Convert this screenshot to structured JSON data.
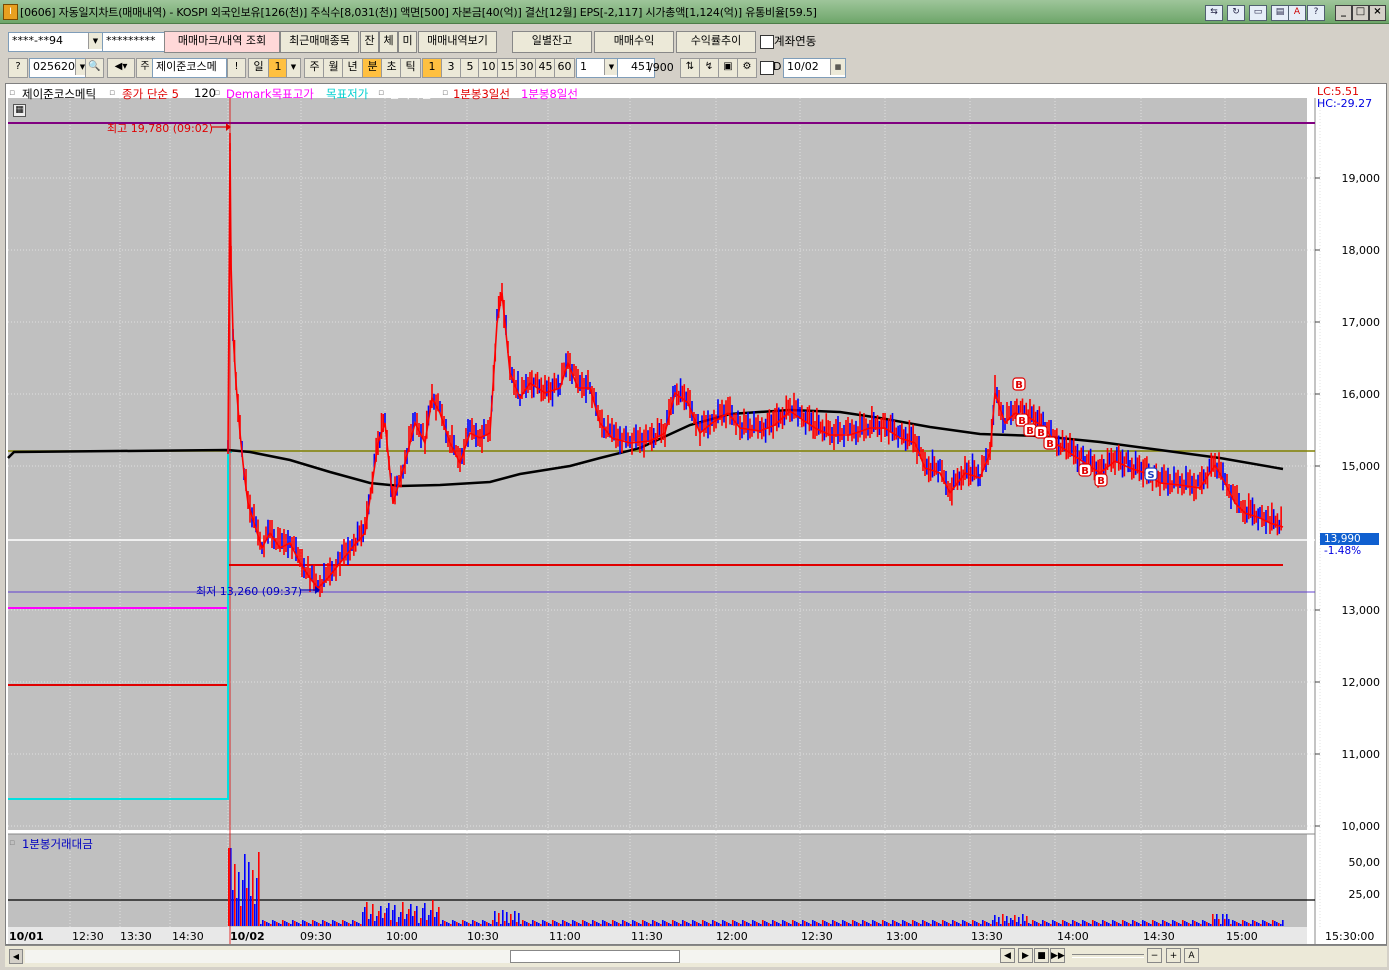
{
  "window": {
    "title": "[0606] 자동일지차트(매매내역) - KOSPI 외국인보유[126(천)] 주식수[8,031(천)] 액면[500] 자본금[40(억)] 결산[12월] EPS[-2,117] 시가총액[1,124(억)] 유통비율[59.5]",
    "app_icon": "I"
  },
  "toolbar1": {
    "account": "****-**94",
    "password": "*********",
    "btn_mark": "매매마크/내역 조회",
    "btn_recent": "최근매매종목",
    "btn_jan": "잔",
    "btn_che": "체",
    "btn_mi": "미",
    "btn_history": "매매내역보기",
    "btn_daily": "일별잔고",
    "btn_profit": "매매수익",
    "btn_return": "수익률추이",
    "chk_link": "계좌연동"
  },
  "toolbar2": {
    "code": "025620",
    "stock_name": "제이준코스메",
    "btn_excl": "!",
    "period_day": "일",
    "period_val": "1",
    "week": "주",
    "month": "월",
    "year": "년",
    "minute": "분",
    "second": "초",
    "tick": "틱",
    "intervals": [
      "1",
      "3",
      "5",
      "10",
      "15",
      "30",
      "45",
      "60"
    ],
    "interval_val": "1",
    "count": "451",
    "count_max": "/900",
    "chk_d": "D",
    "date": "10/02"
  },
  "legend": {
    "name": "제이준코스메틱",
    "close": "종가 단순 5",
    "close_val": "120",
    "demark": "Demark목표고가",
    "target_low": "목표저가",
    "short_over": "단기과열",
    "line3": "1분봉3일선",
    "line8": "1분봉8일선",
    "volume_label": "1분봉거래대금",
    "lc": "LC:5.51",
    "hc": "HC:-29.27"
  },
  "annotations": {
    "high": "최고 19,780 (09:02)",
    "low": "최저 13,260 (09:37)",
    "current_price": "13,990",
    "current_change": "-1.48%"
  },
  "axes": {
    "y_ticks": [
      "19,000",
      "18,000",
      "17,000",
      "16,000",
      "15,000",
      "13,000",
      "12,000",
      "11,000",
      "10,000"
    ],
    "vol_ticks": [
      "50,00",
      "25,00"
    ],
    "x_ticks": [
      "10/01",
      "12:30",
      "13:30",
      "14:30",
      "10/02",
      "09:30",
      "10:00",
      "10:30",
      "11:00",
      "11:30",
      "12:00",
      "12:30",
      "13:00",
      "13:30",
      "14:00",
      "14:30",
      "15:00",
      "15:30:00"
    ]
  },
  "markers": [
    "B",
    "B",
    "B",
    "B",
    "B",
    "B",
    "B",
    "S"
  ],
  "scroll_buttons": [
    "◀",
    "▶",
    "■",
    "▶▶",
    "−",
    "+",
    "A"
  ],
  "colors": {
    "title_bar": "#7eb47a",
    "chart_bg": "#c0c0c0",
    "up": "#ff0000",
    "down": "#0000ff",
    "ma_black": "#000000",
    "olive": "#808000",
    "purple": "#800080",
    "cyan": "#00e0e0",
    "magenta": "#ff00ff"
  }
}
